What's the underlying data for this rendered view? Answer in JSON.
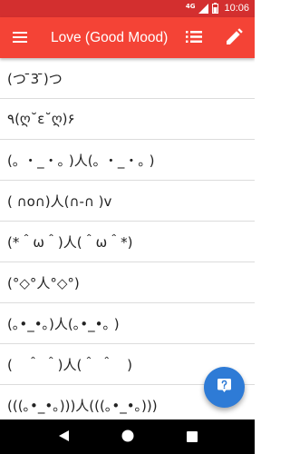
{
  "status_bar": {
    "network_label": "4G",
    "time": "10:06",
    "icons": [
      "signal-icon",
      "battery-icon"
    ]
  },
  "app_bar": {
    "title": "Love (Good Mood)",
    "icons": [
      "menu-icon",
      "list-icon",
      "edit-icon"
    ]
  },
  "emoticons": [
    "(つ ̄3 ̄)つ",
    "٩(ღ˘ε˘ღ)۶",
    "(｡ ・_・｡ )人(｡ ・_・｡ )",
    "( ∩o∩)人(∩-∩ )v",
    "(*＾ω＾)人(＾ω＾*)",
    "(°◇°人°◇°)",
    "(｡•_•｡)人(｡•_•｡ )",
    "(　＾ ＾)人(＾ ＾　)",
    "(((｡•_•｡)))人(((｡•_•｡)))"
  ],
  "fab": {
    "icon": "help-icon"
  },
  "nav_bar": {
    "icons": [
      "back-icon",
      "home-icon",
      "recents-icon"
    ]
  },
  "colors": {
    "status_bar": "#d32f2f",
    "app_bar": "#f44336",
    "fab": "#2e7bd6",
    "divider": "#dcdcdc",
    "text": "#222222",
    "nav_bar": "#000000"
  }
}
